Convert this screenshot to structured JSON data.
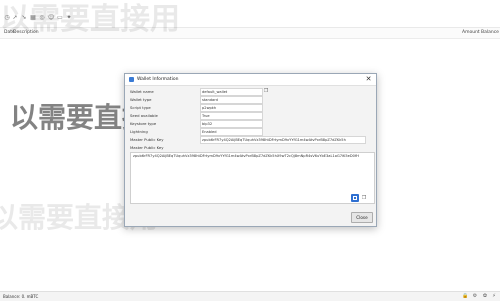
{
  "column_header": {
    "date": "Date",
    "description": "Description",
    "amount": "Amount",
    "balance": "Balance"
  },
  "watermark": {
    "top": "以需要直接用",
    "middle": "以需要直接用",
    "bottom": "以需要直接用"
  },
  "dialog": {
    "title": "Wallet Information",
    "close_glyph": "✕",
    "rows": [
      {
        "label": "Wallet name",
        "value": "default_wallet"
      },
      {
        "label": "Wallet type",
        "value": "standard"
      },
      {
        "label": "Script type",
        "value": "p2wpkh"
      },
      {
        "label": "Seed available",
        "value": "True"
      },
      {
        "label": "Keystore type",
        "value": "bip32"
      },
      {
        "label": "Lightning",
        "value": "Enabled"
      },
      {
        "label": "Master Public Key",
        "value": "zpub6rFR7y4Q2AijBEqTUquhVz398htDFrtymD9xYYfG1m4wAtvPxrB8pZ7dZKk5h"
      }
    ],
    "mpk_label": "Master Public Key",
    "mpk_value": "zpub6rFR7y4Q2AijBEqTUquhVz398htDFrtymD9xYYfG1m4wAtvPxrB8pZ7dZKk5hX9wT2cQj8mNpR4sV6uYbE3aL1oG7iK5eD0fH",
    "close_label": "Close"
  },
  "statusbar": {
    "text": "Balance: 0. mBTC"
  },
  "icons": {
    "toolbar": [
      "history-icon",
      "send-icon",
      "receive-icon",
      "addresses-icon",
      "coins-icon",
      "contacts-icon",
      "console-icon",
      "channels-icon"
    ],
    "status": [
      "lock-icon",
      "settings-icon",
      "seed-icon",
      "lightning-icon"
    ]
  }
}
